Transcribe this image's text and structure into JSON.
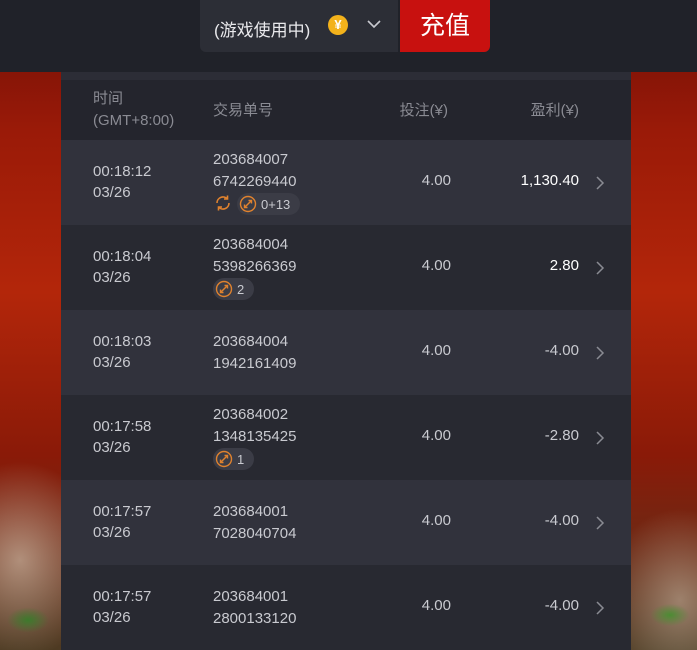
{
  "topbar": {
    "game_status": "(游戏使用中)",
    "coin_symbol": "¥",
    "recharge_label": "充值"
  },
  "table": {
    "headers": {
      "time": "时间",
      "timezone": "(GMT+8:00)",
      "order_id": "交易单号",
      "bet": "投注(¥)",
      "profit": "盈利(¥)"
    },
    "rows": [
      {
        "time": "00:18:12",
        "date": "03/26",
        "id_line1": "203684007",
        "id_line2": "6742269440",
        "bet": "4.00",
        "profit": "1,130.40",
        "badge": "0+13"
      },
      {
        "time": "00:18:04",
        "date": "03/26",
        "id_line1": "203684004",
        "id_line2": "5398266369",
        "bet": "4.00",
        "profit": "2.80",
        "badge": "2"
      },
      {
        "time": "00:18:03",
        "date": "03/26",
        "id_line1": "203684004",
        "id_line2": "1942161409",
        "bet": "4.00",
        "profit": "-4.00"
      },
      {
        "time": "00:17:58",
        "date": "03/26",
        "id_line1": "203684002",
        "id_line2": "1348135425",
        "bet": "4.00",
        "profit": "-2.80",
        "badge": "1"
      },
      {
        "time": "00:17:57",
        "date": "03/26",
        "id_line1": "203684001",
        "id_line2": "7028040704",
        "bet": "4.00",
        "profit": "-4.00"
      },
      {
        "time": "00:17:57",
        "date": "03/26",
        "id_line1": "203684001",
        "id_line2": "2800133120",
        "bet": "4.00",
        "profit": "-4.00"
      }
    ]
  },
  "colors": {
    "accent_red": "#c8110f",
    "coin_gold": "#f3b21b",
    "icon_orange": "#e0822e"
  }
}
